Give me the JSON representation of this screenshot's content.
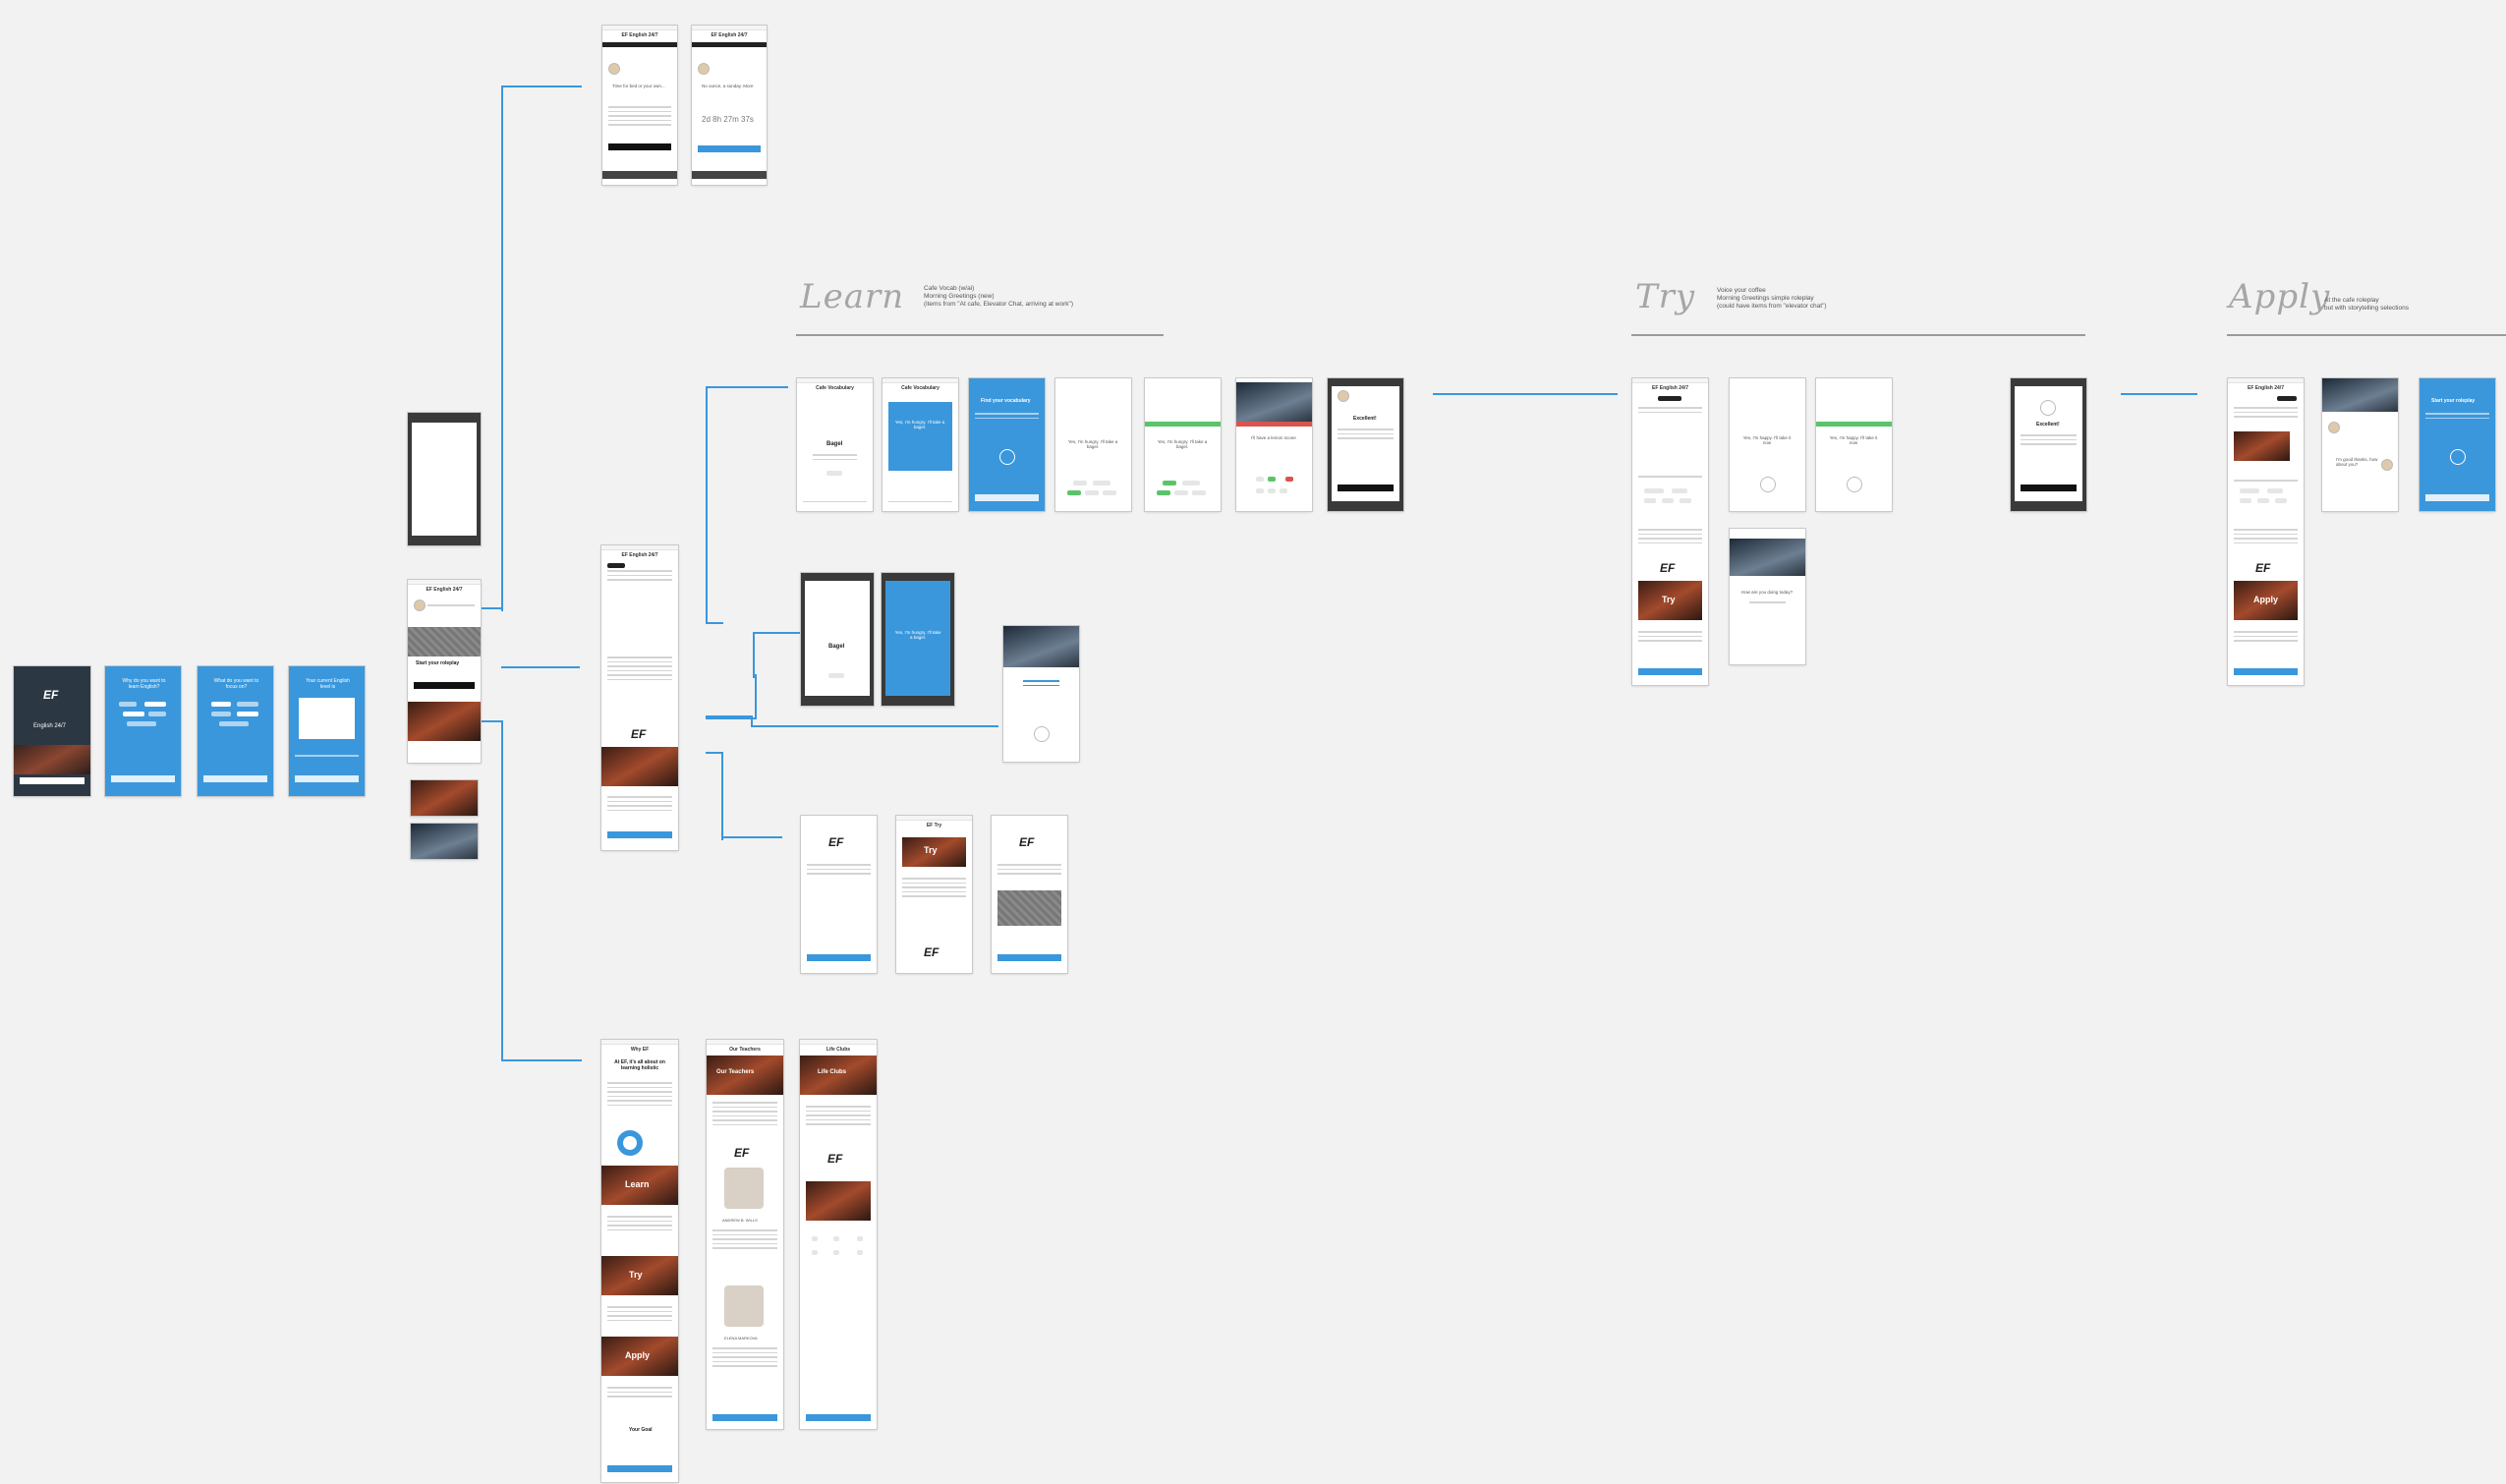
{
  "sections": {
    "learn": {
      "title": "Learn",
      "note": "Cafe Vocab (w/ai)\nMorning Greetings (new)\n(items from \"At cafe, Elevator Chat, arriving at work\")"
    },
    "try": {
      "title": "Try",
      "note": "Voice your coffee\nMorning Greetings simple roleplay\n(could have items from \"elevator chat\")"
    },
    "apply": {
      "title": "Apply",
      "note": "At the cafe roleplay\nbut with storytelling selections"
    }
  },
  "screens": {
    "onboarding": [
      {
        "logo": "EF",
        "title": "English 24/7"
      },
      {
        "question": "Why do you want to learn English?"
      },
      {
        "question": "What do you want to focus on?"
      },
      {
        "question": "Your current English level is"
      }
    ],
    "home": {
      "header": "EF English 24/7",
      "cta": "Start your roleplay"
    },
    "top": [
      {
        "header": "EF English 24/7",
        "heading": "Time for bed or your own..."
      },
      {
        "header": "EF English 24/7",
        "heading": "No ounce, a sunday. More",
        "timer": "2d 8h 27m 37s"
      }
    ],
    "learn_flow": [
      {
        "nav": "Cafe Vocabulary",
        "word": "Bagel"
      },
      {
        "nav": "Cafe Vocabulary",
        "phrase": "Yes, I'm hungry. I'll take a bagel."
      },
      {
        "heading": "Find your vocabulary"
      },
      {
        "phrase": "Yes, I'm hungry. I'll take a bagel."
      },
      {
        "phrase": "Yes, I'm hungry. I'll take a bagel."
      },
      {
        "phrase": "I'll have a lemon scone"
      },
      {
        "heading": "Excellent!"
      }
    ],
    "try_flow": [
      {
        "header": "EF English 24/7",
        "logo": "EF",
        "tile": "Try"
      },
      {
        "phrase": "Yes, I'm happy. I'll take it now"
      },
      {
        "phrase": "Yes, I'm happy. I'll take it now"
      },
      {
        "heading": "How are you doing today?"
      },
      {
        "heading": "Excellent!"
      }
    ],
    "apply_flow": [
      {
        "header": "EF English 24/7",
        "logo": "EF",
        "tile": "Apply"
      },
      {
        "phrase": "I'm good thanks, how about you?"
      },
      {
        "heading": "Start your roleplay"
      }
    ],
    "why_ef": {
      "nav": "Why EF",
      "heading": "At EF, it's all about on learning holistic",
      "tiles": [
        "Learn",
        "Try",
        "Apply"
      ],
      "footer_heading": "Your Goal"
    },
    "teachers": {
      "nav": "Our Teachers",
      "tile": "Our Teachers",
      "logo": "EF",
      "names": [
        "ANDREW B. WILLS",
        "ELENA MARKOVA"
      ]
    },
    "life_clubs": {
      "nav": "Life Clubs",
      "tile": "Life Clubs",
      "logo": "EF"
    },
    "middle": [
      {
        "header": "EF English 24/7",
        "logo": "EF"
      },
      {
        "header": "EF Try",
        "tile": "Try",
        "logo": "EF"
      },
      {
        "header": "EF English 24/7",
        "logo": "EF"
      }
    ]
  },
  "colors": {
    "connector": "#3a97dc",
    "blue": "#3a97dc",
    "background": "#f2f2f2"
  }
}
